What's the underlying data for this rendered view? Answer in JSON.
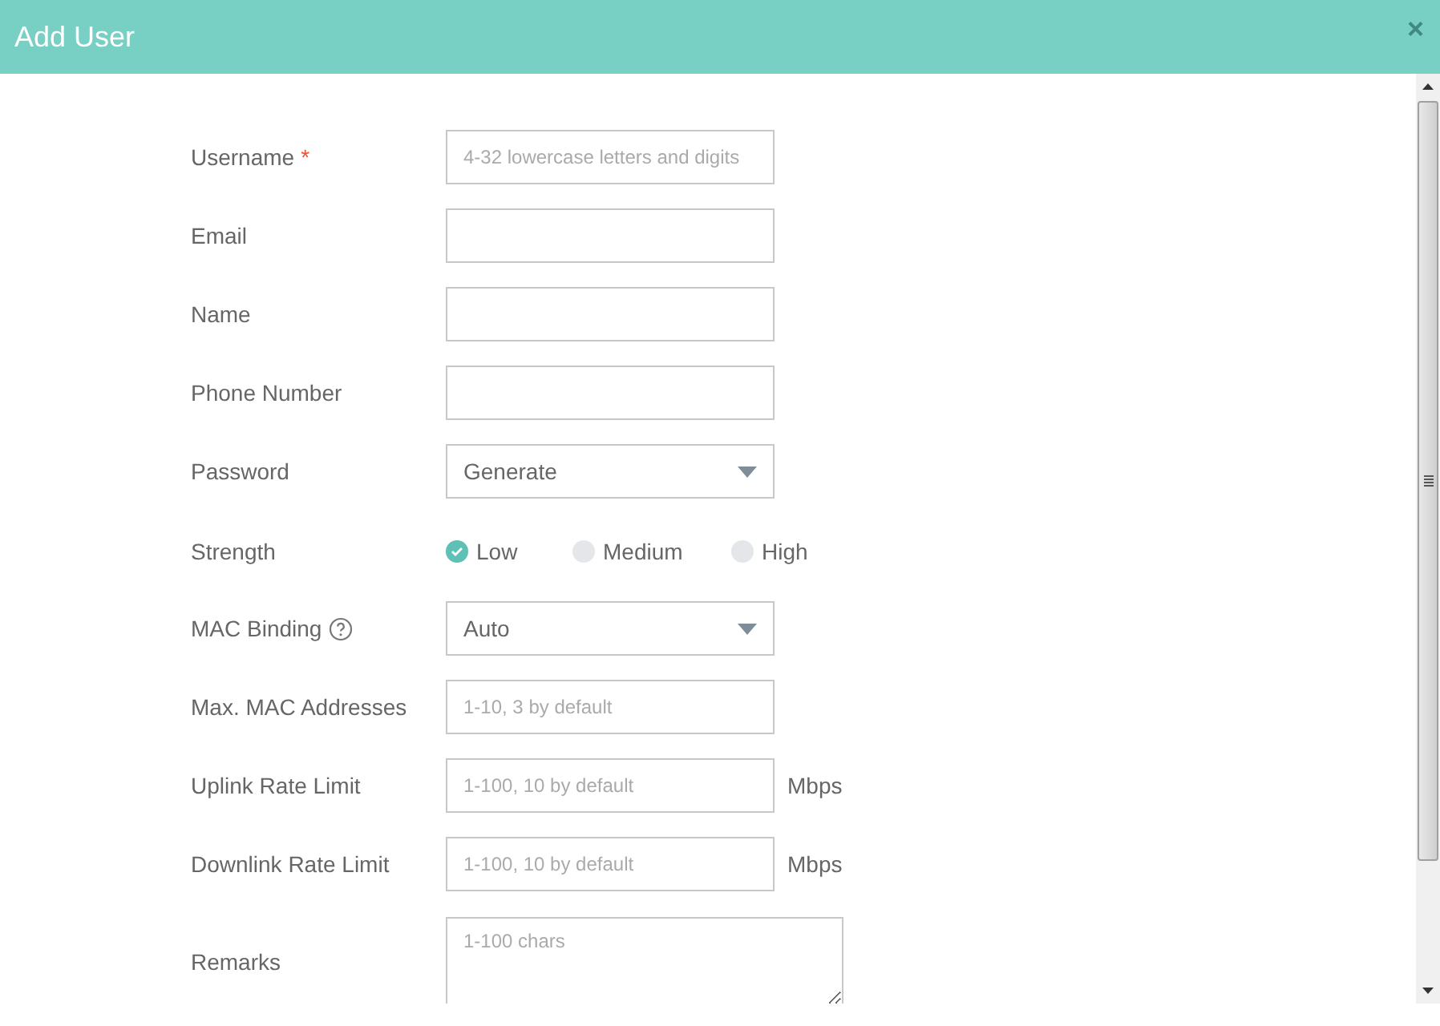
{
  "dialog": {
    "title": "Add User",
    "close": "×"
  },
  "fields": [
    {
      "kind": "text",
      "label": "Username",
      "required_mark": "*",
      "help": false,
      "placeholder": "4-32 lowercase letters and digits"
    },
    {
      "kind": "text",
      "label": "Email",
      "help": false
    },
    {
      "kind": "text",
      "label": "Name",
      "help": false
    },
    {
      "kind": "text",
      "label": "Phone Number",
      "help": false
    },
    {
      "kind": "select",
      "label": "Password",
      "help": false,
      "value": "Generate"
    },
    {
      "kind": "radio",
      "label": "Strength",
      "help": false,
      "options": [
        {
          "label": "Low",
          "selected": true
        },
        {
          "label": "Medium",
          "selected": false
        },
        {
          "label": "High",
          "selected": false
        }
      ]
    },
    {
      "kind": "select",
      "label": "MAC Binding",
      "help": true,
      "value": "Auto"
    },
    {
      "kind": "text",
      "label": "Max. MAC Addresses",
      "help": false,
      "placeholder": "1-10, 3 by default"
    },
    {
      "kind": "text",
      "label": "Uplink Rate Limit",
      "help": false,
      "placeholder": "1-100, 10 by default",
      "unit": "Mbps"
    },
    {
      "kind": "text",
      "label": "Downlink Rate Limit",
      "help": false,
      "placeholder": "1-100, 10 by default",
      "unit": "Mbps"
    },
    {
      "kind": "textarea",
      "label": "Remarks",
      "help": false,
      "placeholder": "1-100 chars"
    }
  ]
}
